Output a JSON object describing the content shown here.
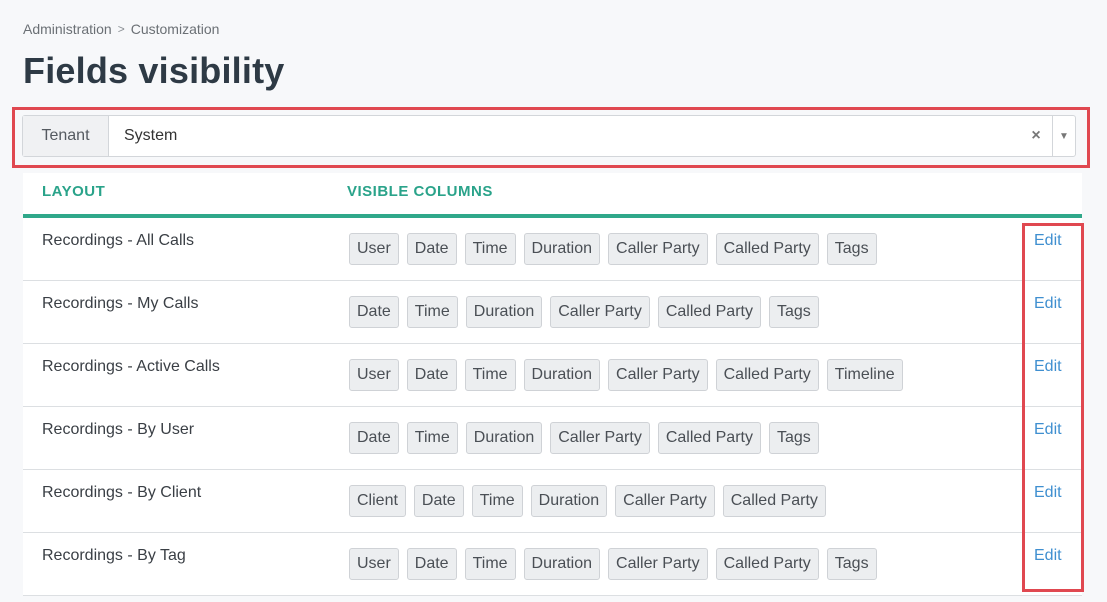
{
  "breadcrumb": {
    "items": [
      "Administration",
      "Customization"
    ],
    "separator": ">"
  },
  "page": {
    "title": "Fields visibility"
  },
  "tenant": {
    "label": "Tenant",
    "value": "System",
    "clear": "×",
    "caret": "▼"
  },
  "table": {
    "headers": {
      "layout": "LAYOUT",
      "visible_columns": "VISIBLE COLUMNS"
    },
    "edit_label": "Edit",
    "rows": [
      {
        "name": "Recordings - All Calls",
        "columns": [
          "User",
          "Date",
          "Time",
          "Duration",
          "Caller Party",
          "Called Party",
          "Tags"
        ]
      },
      {
        "name": "Recordings - My Calls",
        "columns": [
          "Date",
          "Time",
          "Duration",
          "Caller Party",
          "Called Party",
          "Tags"
        ]
      },
      {
        "name": "Recordings - Active Calls",
        "columns": [
          "User",
          "Date",
          "Time",
          "Duration",
          "Caller Party",
          "Called Party",
          "Timeline"
        ]
      },
      {
        "name": "Recordings - By User",
        "columns": [
          "Date",
          "Time",
          "Duration",
          "Caller Party",
          "Called Party",
          "Tags"
        ]
      },
      {
        "name": "Recordings - By Client",
        "columns": [
          "Client",
          "Date",
          "Time",
          "Duration",
          "Caller Party",
          "Called Party"
        ]
      },
      {
        "name": "Recordings - By Tag",
        "columns": [
          "User",
          "Date",
          "Time",
          "Duration",
          "Caller Party",
          "Called Party",
          "Tags"
        ]
      }
    ]
  },
  "colors": {
    "accent": "#2fa88a",
    "link": "#3f8fd0",
    "highlight": "#e04850"
  }
}
